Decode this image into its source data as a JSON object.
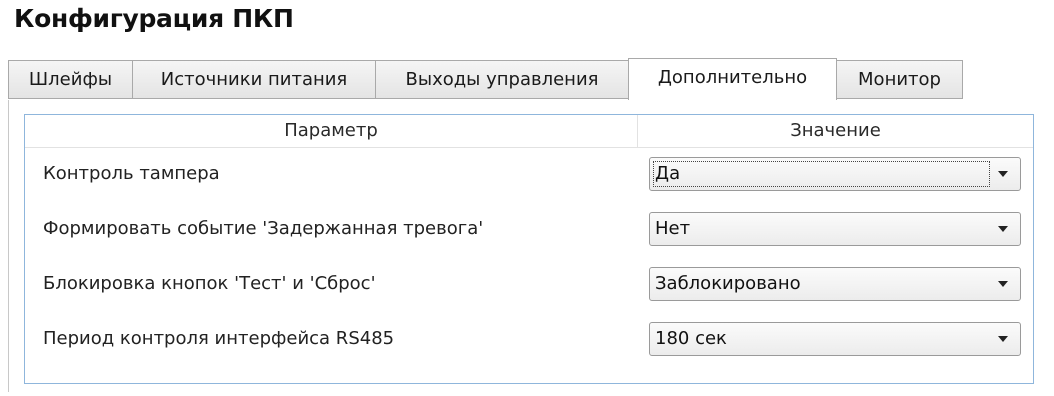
{
  "window": {
    "title": "Конфигурация ПКП"
  },
  "tabs": [
    {
      "label": "Шлейфы",
      "active": false
    },
    {
      "label": "Источники питания",
      "active": false
    },
    {
      "label": "Выходы управления",
      "active": false
    },
    {
      "label": "Дополнительно",
      "active": true
    },
    {
      "label": "Монитор",
      "active": false
    }
  ],
  "grid": {
    "header": {
      "parameter": "Параметр",
      "value": "Значение"
    },
    "rows": [
      {
        "parameter": "Контроль тампера",
        "value": "Да"
      },
      {
        "parameter": "Формировать событие 'Задержанная тревога'",
        "value": "Нет"
      },
      {
        "parameter": "Блокировка кнопок 'Тест' и 'Сброс'",
        "value": "Заблокировано"
      },
      {
        "parameter": "Период контроля интерфейса RS485",
        "value": "180 сек"
      }
    ]
  },
  "icons": {
    "dropdown": "chevron-down-icon"
  },
  "colors": {
    "panel_border": "#8fb6dc",
    "tab_border": "#a9a9a9"
  }
}
